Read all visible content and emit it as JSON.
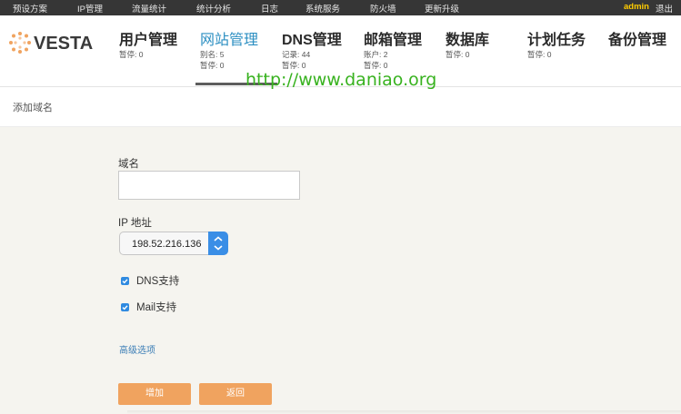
{
  "topmenu": {
    "items": [
      "预设方案",
      "IP管理",
      "流量统计",
      "统计分析",
      "日志",
      "系统服务",
      "防火墙",
      "更新升级"
    ],
    "user": "admin",
    "logout": "退出"
  },
  "logo": {
    "text": "VESTA"
  },
  "nav": [
    {
      "title": "用户管理",
      "stat1": "暂停: 0",
      "stat2": ""
    },
    {
      "title": "网站管理",
      "stat1": "别名: 5",
      "stat2": "暂停: 0",
      "active": true
    },
    {
      "title": "DNS管理",
      "stat1": "记录: 44",
      "stat2": "暂停: 0"
    },
    {
      "title": "邮箱管理",
      "stat1": "账户: 2",
      "stat2": "暂停: 0"
    },
    {
      "title": "数据库",
      "stat1": "暂停: 0",
      "stat2": ""
    },
    {
      "title": "计划任务",
      "stat1": "暂停: 0",
      "stat2": ""
    },
    {
      "title": "备份管理",
      "stat1": "",
      "stat2": ""
    }
  ],
  "breadcrumb": "添加域名",
  "form": {
    "domain_label": "域名",
    "domain_value": "",
    "ip_label": "IP 地址",
    "ip_value": "198.52.216.136",
    "dns_label": "DNS支持",
    "dns_checked": true,
    "mail_label": "Mail支持",
    "mail_checked": true,
    "advanced_link": "高级选项",
    "add_button": "增加",
    "back_button": "返回"
  },
  "watermark": "http://www.daniao.org",
  "colors": {
    "topbar": "#363636",
    "user": "#ffcc00",
    "active_nav": "#2c8fc2",
    "button": "#f0a35f",
    "checkbox": "#2f8ae0",
    "watermark": "#38b21f"
  }
}
